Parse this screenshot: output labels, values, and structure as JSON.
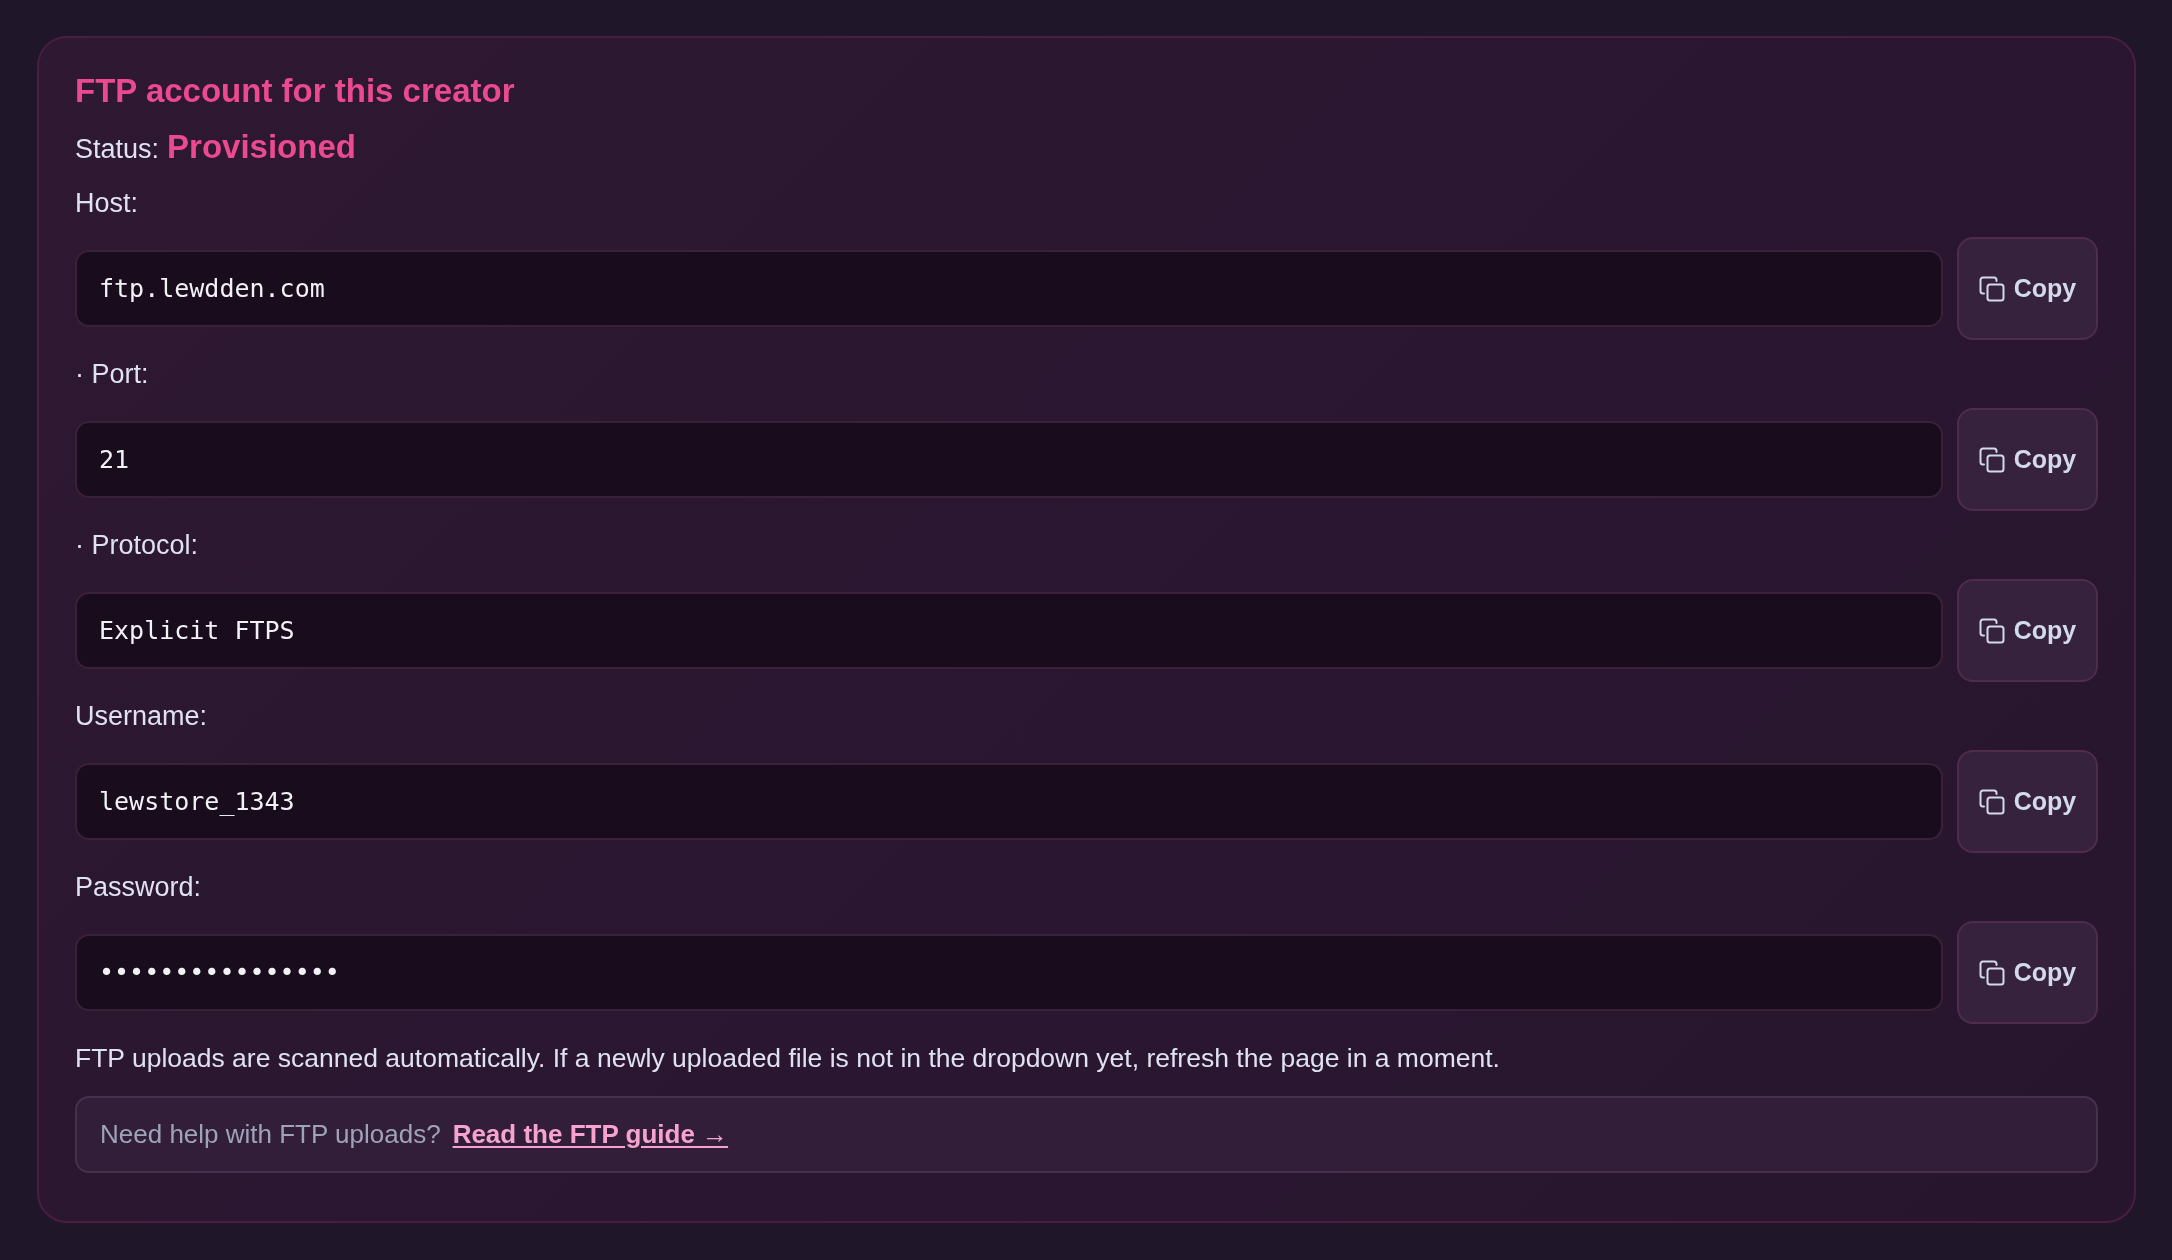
{
  "card": {
    "title": "FTP account for this creator",
    "status": {
      "label": "Status:",
      "value": "Provisioned"
    },
    "fields": [
      {
        "label": "Host:",
        "value": "ftp.lewdden.com",
        "button": "Copy"
      },
      {
        "label": "· Port:",
        "value": "21",
        "button": "Copy"
      },
      {
        "label": "· Protocol:",
        "value": "Explicit FTPS",
        "button": "Copy"
      },
      {
        "label": "Username:",
        "value": "lewstore_1343",
        "button": "Copy"
      },
      {
        "label": "Password:",
        "value": "••••••••••••••••",
        "button": "Copy"
      }
    ],
    "note": "FTP uploads are scanned automatically. If a newly uploaded file is not in the dropdown yet, refresh the page in a moment.",
    "help": {
      "text": "Need help with FTP uploads?",
      "link": "Read the FTP guide →"
    }
  }
}
